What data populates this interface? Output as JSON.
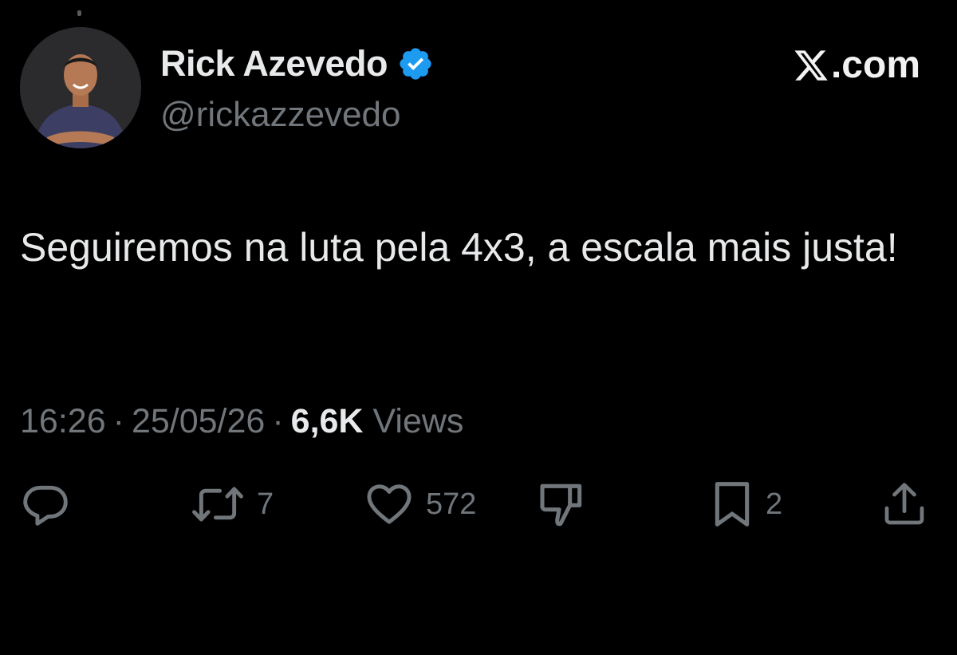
{
  "author": {
    "display_name": "Rick Azevedo",
    "handle": "@rickazzevedo",
    "verified": true,
    "verified_color": "#1d9bf0"
  },
  "brand": {
    "label": ".com",
    "logo_icon": "x-logo-icon"
  },
  "tweet": {
    "text": "Seguiremos na luta pela 4x3, a escala mais justa!"
  },
  "meta": {
    "time": "16:26",
    "separator": "·",
    "date": "25/05/26",
    "views_count": "6,6K",
    "views_label": "Views"
  },
  "actions": {
    "reply": {
      "icon": "reply-icon"
    },
    "repost": {
      "icon": "repost-icon",
      "count": "7"
    },
    "like": {
      "icon": "heart-icon",
      "count": "572"
    },
    "dislike": {
      "icon": "thumbs-down-icon"
    },
    "bookmark": {
      "icon": "bookmark-icon",
      "count": "2"
    },
    "share": {
      "icon": "share-icon"
    }
  },
  "colors": {
    "background": "#000000",
    "primary_text": "#e7e9ea",
    "secondary_text": "#71767b",
    "accent": "#1d9bf0"
  }
}
